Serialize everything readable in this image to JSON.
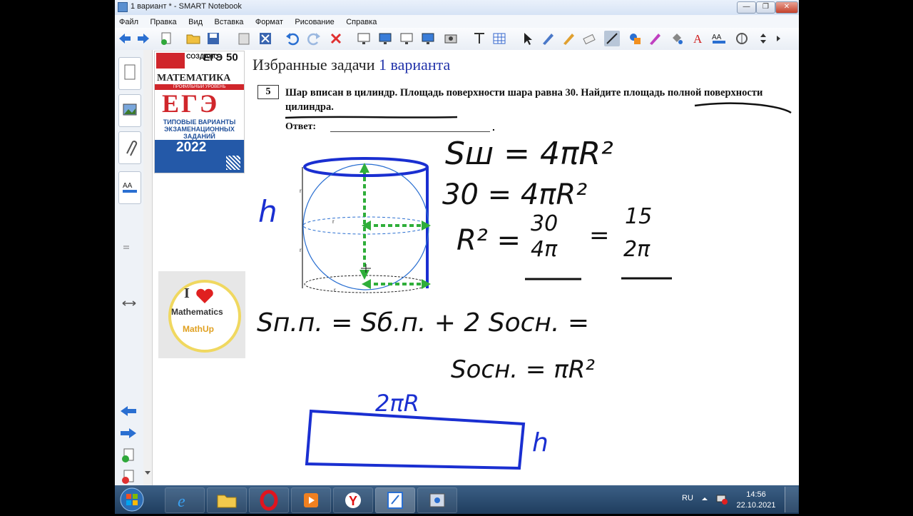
{
  "window": {
    "title": "1 вариант * - SMART Notebook",
    "controls": [
      "—",
      "❐",
      "✕"
    ]
  },
  "menu": [
    "Файл",
    "Правка",
    "Вид",
    "Вставка",
    "Формат",
    "Рисование",
    "Справка"
  ],
  "toolbar_icons": [
    "back-arrow",
    "forward-arrow",
    "add-page",
    "open-file",
    "save",
    "paste",
    "delete-page",
    "undo",
    "redo",
    "delete",
    "screen-shade",
    "show-all",
    "display-screen",
    "dual-page",
    "capture",
    "table-tool",
    "insert-table",
    "select-tool",
    "pen-tool",
    "creative-pen",
    "eraser",
    "line-tool",
    "shapes-tool",
    "magic-pen",
    "fill",
    "text-tool",
    "properties",
    "measurement",
    "move-toolbar",
    "more"
  ],
  "side_tabs": [
    "page-sorter-icon",
    "gallery-icon",
    "attachments-icon",
    "properties-icon"
  ],
  "page": {
    "title_prefix": "Избранные задачи ",
    "title_highlight": "1 варианта",
    "task_number": "5",
    "task_text": "Шар вписан в цилиндр. Площадь поверхности шара равна 30. Найдите площадь полной поверхности цилиндра.",
    "answer_label": "Ответ:",
    "answer_dot": ".",
    "book": {
      "top_label": "СОЗДАНО",
      "series": "ЕГЭ",
      "variants": "50",
      "subject": "МАТЕМАТИКА",
      "level": "ПРОФИЛЬНЫЙ УРОВЕНЬ",
      "exam": "ЕГЭ",
      "desc": "ТИПОВЫЕ ВАРИАНТЫ ЭКЗАМЕНАЦИОННЫХ ЗАДАНИЙ",
      "year": "2022"
    },
    "badge": {
      "line1": "I",
      "line2": "Mathematics",
      "line3": "MathUp"
    },
    "handwriting": {
      "h_left": "h",
      "eq1": "Sш = 4πR²",
      "eq2": "30 = 4πR²",
      "eq3_lhs": "R² =",
      "eq3_frac1_num": "30",
      "eq3_frac1_den": "4π",
      "eq3_eq": "=",
      "eq3_frac2_num": "15",
      "eq3_frac2_den": "2π",
      "eq4": "Sп.п. = Sб.п. + 2 Sосн. =",
      "eq5": "Sосн. = πR²",
      "rect_top": "2πR",
      "rect_right": "h"
    },
    "cyl_labels": [
      "r",
      "r",
      "r",
      "r"
    ]
  },
  "taskbar": {
    "apps": [
      "windows-start",
      "ie-icon",
      "explorer-icon",
      "opera-icon",
      "media-icon",
      "yandex-icon",
      "notebook-icon",
      "smart-tools-icon"
    ],
    "lang": "RU",
    "time": "14:56",
    "date": "22.10.2021"
  }
}
